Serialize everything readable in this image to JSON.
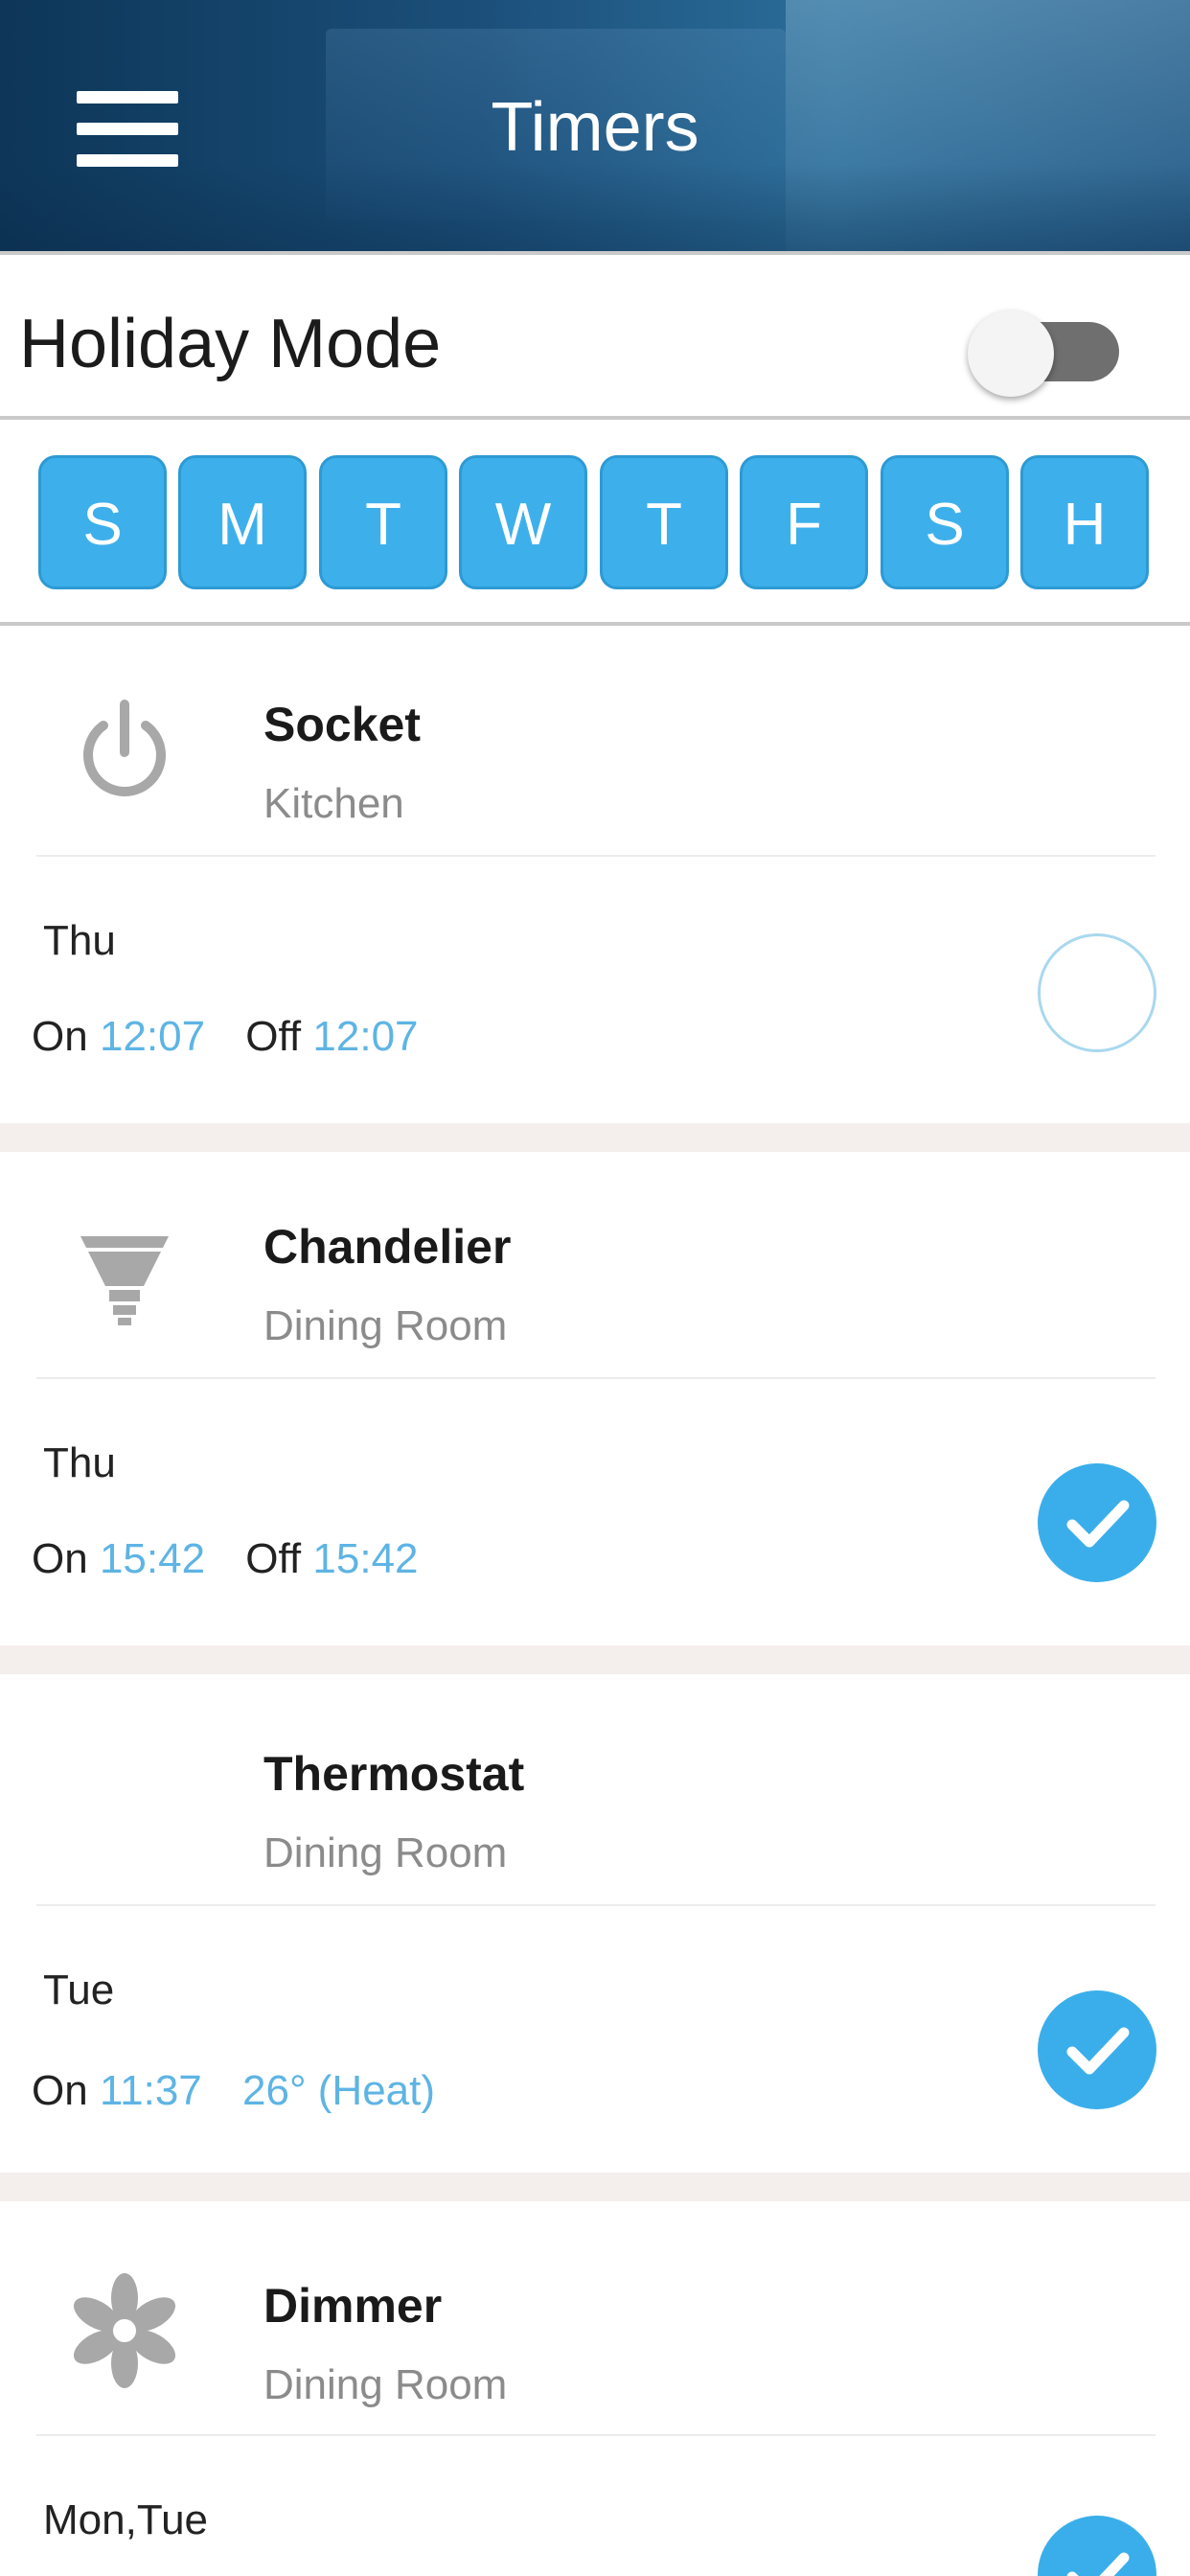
{
  "header": {
    "title": "Timers"
  },
  "holiday": {
    "label": "Holiday Mode",
    "enabled": false
  },
  "days": [
    "S",
    "M",
    "T",
    "W",
    "T",
    "F",
    "S",
    "H"
  ],
  "colors": {
    "accent": "#3db0ec",
    "time_blue": "#5eb4e4",
    "header_dark": "#0d3658"
  },
  "timers": [
    {
      "name": "Socket",
      "room": "Kitchen",
      "icon": "power-icon",
      "days": "Thu",
      "on_label": "On",
      "on_time": "12:07",
      "second_label": "Off",
      "second_value": "12:07",
      "checked": false
    },
    {
      "name": "Chandelier",
      "room": "Dining Room",
      "icon": "light-bulb-icon",
      "days": "Thu",
      "on_label": "On",
      "on_time": "15:42",
      "second_label": "Off",
      "second_value": "15:42",
      "checked": true
    },
    {
      "name": "Thermostat",
      "room": "Dining Room",
      "icon": "",
      "days": "Tue",
      "on_label": "On",
      "on_time": "11:37",
      "second_label": "",
      "second_value": "26° (Heat)",
      "checked": true
    },
    {
      "name": "Dimmer",
      "room": "Dining Room",
      "icon": "fan-icon",
      "days": "Mon,Tue",
      "checked": true
    }
  ]
}
